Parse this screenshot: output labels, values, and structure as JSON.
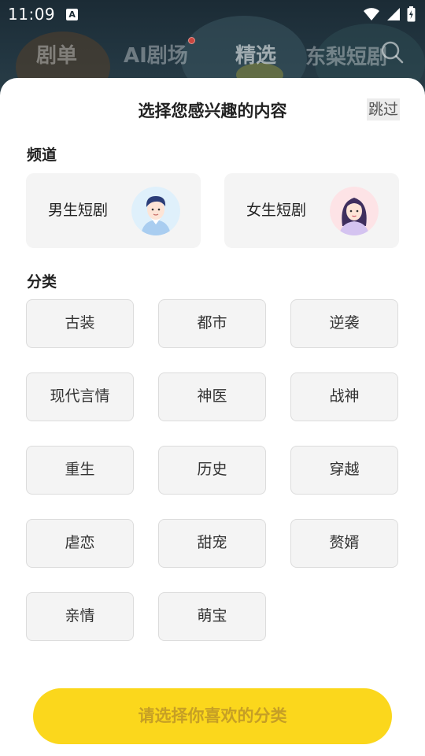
{
  "status_bar": {
    "time": "11:09",
    "notification_icon": "A",
    "icons": [
      "wifi-icon",
      "signal-icon",
      "battery-icon"
    ]
  },
  "top_nav": {
    "tabs": [
      {
        "label": "剧单"
      },
      {
        "label": "AI剧场"
      },
      {
        "label": "精选"
      },
      {
        "label": "东梨短剧"
      }
    ],
    "active_tab": "精选",
    "search_icon": "search-icon"
  },
  "sheet": {
    "title": "选择您感兴趣的内容",
    "skip_label": "跳过",
    "channel_heading": "频道",
    "channels": [
      {
        "label": "男生短剧",
        "avatar": "male-avatar-icon"
      },
      {
        "label": "女生短剧",
        "avatar": "female-avatar-icon"
      }
    ],
    "category_heading": "分类",
    "categories": [
      {
        "label": "古装"
      },
      {
        "label": "都市"
      },
      {
        "label": "逆袭"
      },
      {
        "label": "现代言情"
      },
      {
        "label": "神医"
      },
      {
        "label": "战神"
      },
      {
        "label": "重生"
      },
      {
        "label": "历史"
      },
      {
        "label": "穿越"
      },
      {
        "label": "虐恋"
      },
      {
        "label": "甜宠"
      },
      {
        "label": "赘婿"
      },
      {
        "label": "亲情"
      },
      {
        "label": "萌宝"
      }
    ],
    "cta_label": "请选择你喜欢的分类"
  },
  "colors": {
    "accent": "#fbd71c",
    "sheet_bg": "#ffffff",
    "chip_bg": "#f4f4f4",
    "chip_border": "#dcdcdc"
  }
}
